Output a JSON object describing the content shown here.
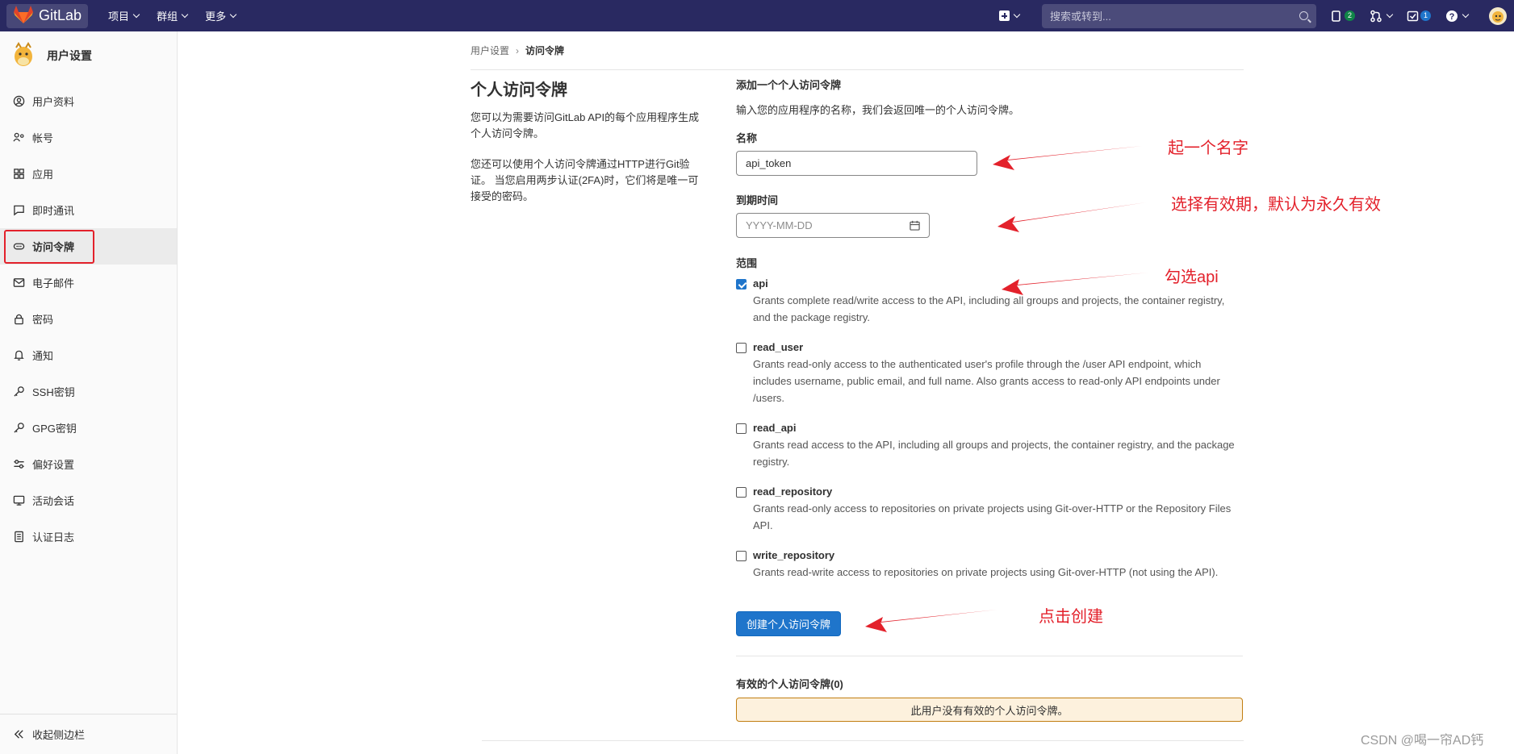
{
  "topbar": {
    "brand": "GitLab",
    "menus": [
      "项目",
      "群组",
      "更多"
    ],
    "search_placeholder": "搜索或转到...",
    "issues_count": "2",
    "todos_count": "1"
  },
  "sidebar": {
    "title": "用户设置",
    "items": [
      "用户资料",
      "帐号",
      "应用",
      "即时通讯",
      "访问令牌",
      "电子邮件",
      "密码",
      "通知",
      "SSH密钥",
      "GPG密钥",
      "偏好设置",
      "活动会话",
      "认证日志"
    ],
    "active_item": "访问令牌",
    "collapse_label": "收起侧边栏"
  },
  "breadcrumb": {
    "parent": "用户设置",
    "current": "访问令牌"
  },
  "intro": {
    "title": "个人访问令牌",
    "paragraph1": "您可以为需要访问GitLab API的每个应用程序生成个人访问令牌。",
    "paragraph2": "您还可以使用个人访问令牌通过HTTP进行Git验证。 当您启用两步认证(2FA)时，它们将是唯一可接受的密码。"
  },
  "form": {
    "heading": "添加一个个人访问令牌",
    "subheading": "输入您的应用程序的名称，我们会返回唯一的个人访问令牌。",
    "name_label": "名称",
    "name_value": "api_token",
    "expires_label": "到期时间",
    "expires_placeholder": "YYYY-MM-DD",
    "scopes_label": "范围",
    "scopes": [
      {
        "name": "api",
        "checked": true,
        "desc": "Grants complete read/write access to the API, including all groups and projects, the container registry, and the package registry."
      },
      {
        "name": "read_user",
        "checked": false,
        "desc": "Grants read-only access to the authenticated user's profile through the /user API endpoint, which includes username, public email, and full name. Also grants access to read-only API endpoints under /users."
      },
      {
        "name": "read_api",
        "checked": false,
        "desc": "Grants read access to the API, including all groups and projects, the container registry, and the package registry."
      },
      {
        "name": "read_repository",
        "checked": false,
        "desc": "Grants read-only access to repositories on private projects using Git-over-HTTP or the Repository Files API."
      },
      {
        "name": "write_repository",
        "checked": false,
        "desc": "Grants read-write access to repositories on private projects using Git-over-HTTP (not using the API)."
      }
    ],
    "submit_label": "创建个人访问令牌"
  },
  "active_tokens": {
    "title": "有效的个人访问令牌(0)",
    "empty_message": "此用户没有有效的个人访问令牌。"
  },
  "annotations": {
    "name_note": "起一个名字",
    "expiry_note": "选择有效期，默认为永久有效",
    "scope_note": "勾选api",
    "create_note": "点击创建",
    "color": "#e3212b"
  },
  "watermark": "CSDN @喝一帘AD钙",
  "colors": {
    "navbar": "#292961",
    "primary": "#1f75cb",
    "highlight": "#e3212b"
  }
}
